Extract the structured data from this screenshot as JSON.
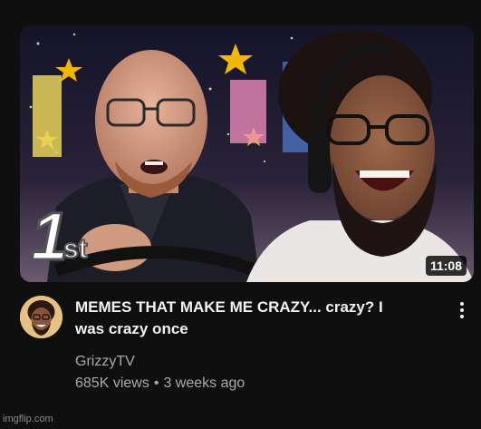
{
  "video": {
    "duration": "11:08",
    "title_line1": "MEMES THAT MAKE ME CRAZY... crazy? I",
    "title_line2": "was crazy once",
    "channel": "GrizzyTV",
    "views": "685K views",
    "separator": "•",
    "age": "3 weeks ago"
  },
  "thumbnail": {
    "badge_number": "1",
    "badge_suffix": "st"
  },
  "icons": {
    "more": "vertical-ellipsis-icon"
  },
  "watermark": "imgflip.com",
  "colors": {
    "background": "#0f0f0f",
    "title": "#f1f1f1",
    "secondary": "#aaaaaa"
  }
}
